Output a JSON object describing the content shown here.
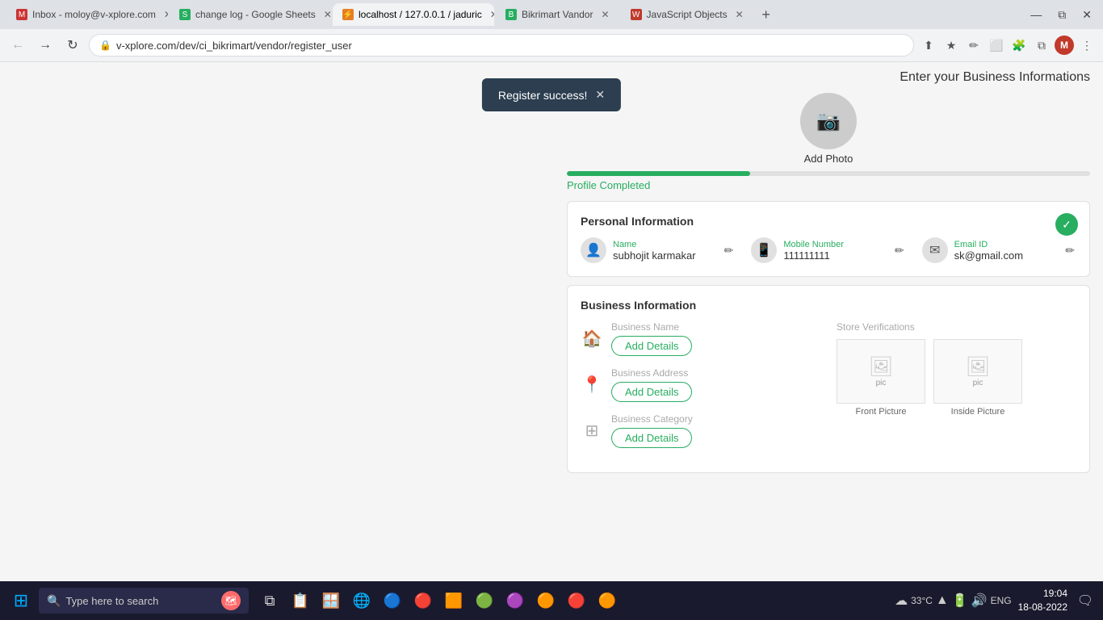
{
  "browser": {
    "tabs": [
      {
        "id": "tab1",
        "favicon_color": "#cc3333",
        "label": "Inbox - moloy@v-xplore.com",
        "active": false
      },
      {
        "id": "tab2",
        "favicon_color": "#27ae60",
        "label": "change log - Google Sheets",
        "active": false
      },
      {
        "id": "tab3",
        "favicon_color": "#e67e22",
        "label": "localhost / 127.0.0.1 / jaduric",
        "active": true
      },
      {
        "id": "tab4",
        "favicon_color": "#27ae60",
        "label": "Bikrimart Vandor",
        "active": false
      },
      {
        "id": "tab5",
        "favicon_color": "#c0392b",
        "label": "JavaScript Objects",
        "active": false
      }
    ],
    "url": "v-xplore.com/dev/ci_bikrimart/vendor/register_user"
  },
  "toast": {
    "message": "Register success!",
    "close_icon": "✕"
  },
  "page": {
    "business_info_title": "Enter your Business Informations",
    "photo": {
      "add_label": "Add Photo"
    },
    "progress": {
      "label": "Profile Completed",
      "percent": 35
    },
    "personal_info": {
      "section_title": "Personal Information",
      "fields": [
        {
          "icon": "👤",
          "label": "Name",
          "value": "subhojit karmakar"
        },
        {
          "icon": "📱",
          "label": "Mobile Number",
          "value": "111111111"
        },
        {
          "icon": "✉",
          "label": "Email ID",
          "value": "sk@gmail.com"
        }
      ]
    },
    "business_info": {
      "section_title": "Business Information",
      "fields": [
        {
          "icon": "🏠",
          "label": "Business Name",
          "btn_label": "Add Details"
        },
        {
          "icon": "📍",
          "label": "Business Address",
          "btn_label": "Add Details"
        },
        {
          "icon": "⊞",
          "label": "Business Category",
          "btn_label": "Add Details"
        }
      ],
      "store_verifications": {
        "label": "Store Verifications",
        "pictures": [
          {
            "label": "Front Picture"
          },
          {
            "label": "Inside Picture"
          }
        ]
      }
    }
  },
  "taskbar": {
    "search_placeholder": "Type here to search",
    "time": "19:04",
    "date": "18-08-2022",
    "temperature": "33°C",
    "language": "ENG",
    "icons": [
      "🗂",
      "📋",
      "🪟",
      "🌐",
      "🔵",
      "🔴",
      "🔶",
      "🔵",
      "🟣",
      "🟠",
      "🔴",
      "🟠"
    ]
  }
}
